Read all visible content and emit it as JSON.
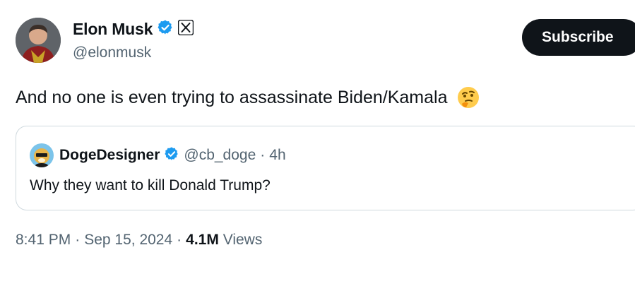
{
  "author": {
    "name": "Elon Musk",
    "handle": "@elonmusk"
  },
  "subscribe_label": "Subscribe",
  "tweet": {
    "text": "And no one is even trying to assassinate Biden/Kamala"
  },
  "quote": {
    "name": "DogeDesigner",
    "handle": "@cb_doge",
    "separator": "·",
    "time": "4h",
    "text": "Why they want to kill Donald Trump?"
  },
  "footer": {
    "time": "8:41 PM",
    "sep1": "·",
    "date": "Sep 15, 2024",
    "sep2": "·",
    "views_count": "4.1M",
    "views_label": "Views"
  },
  "icons": {
    "verified": "verified-badge-icon",
    "x_logo": "x-logo-icon",
    "emoji": "thinking-face-emoji"
  },
  "colors": {
    "verified_blue": "#1d9bf0",
    "subscribe_bg": "#0f1419",
    "secondary_text": "#536471"
  }
}
